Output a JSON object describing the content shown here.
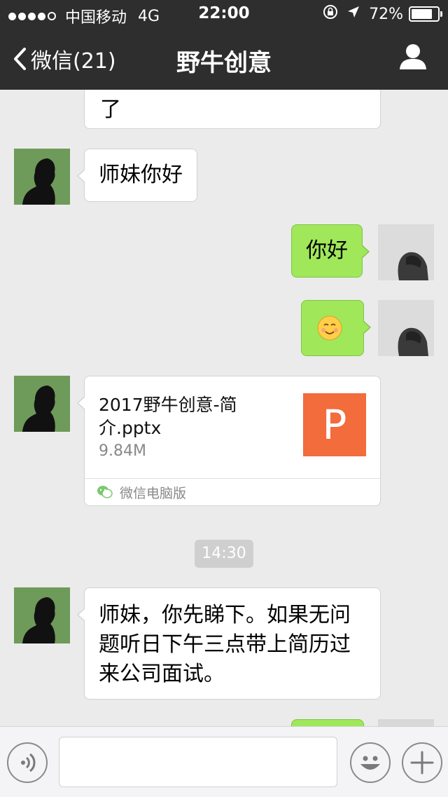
{
  "status_bar": {
    "carrier": "中国移动",
    "network": "4G",
    "time": "22:00",
    "battery": "72%",
    "battery_level": 0.72,
    "signal_dots_filled": 4,
    "signal_dots_total": 5
  },
  "nav": {
    "back_label": "微信(21)",
    "title": "野牛创意",
    "icons": [
      "chevron-left-icon",
      "person-icon"
    ]
  },
  "messages": [
    {
      "side": "left",
      "text": "了",
      "partial": true
    },
    {
      "side": "left",
      "text": "师妹你好"
    },
    {
      "side": "right",
      "text": "你好"
    },
    {
      "side": "right",
      "type": "emoji",
      "icon": "smile-emoji-icon"
    },
    {
      "side": "left",
      "type": "file",
      "file_name": "2017野牛创意-简介.pptx",
      "file_size": "9.84M",
      "file_icon_letter": "P",
      "source": "微信电脑版"
    },
    {
      "type": "time",
      "text": "14:30"
    },
    {
      "side": "left",
      "text": "师妹，你先睇下。如果无问题听日下午三点带上简历过来公司面试。"
    }
  ],
  "input_bar": {
    "icons": [
      "voice-icon",
      "emoji-icon",
      "plus-icon"
    ],
    "value": ""
  },
  "colors": {
    "nav_bg": "#2e2e2e",
    "chat_bg": "#ebebeb",
    "own_bubble": "#a0e75a",
    "file_icon": "#f26c3c"
  }
}
